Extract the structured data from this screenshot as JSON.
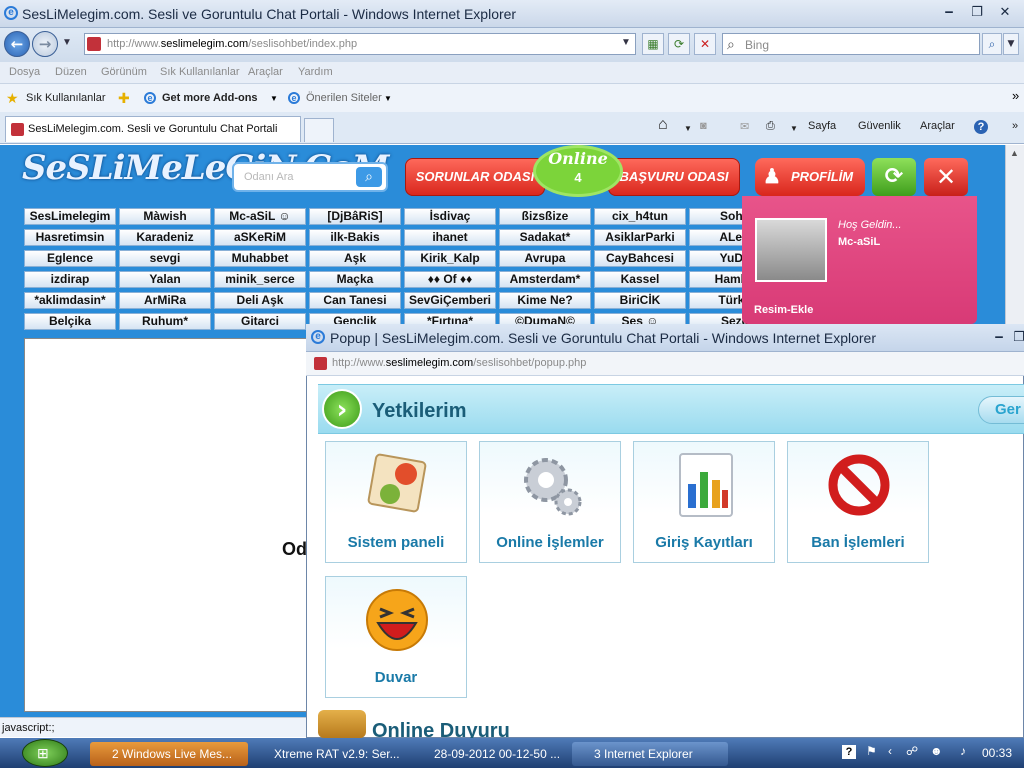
{
  "window": {
    "title": "SesLiMelegim.com. Sesli ve Goruntulu Chat Portali - Windows Internet Explorer"
  },
  "address": {
    "url_prefix": "http://www.",
    "url_domain": "seslimelegim.com",
    "url_path": "/seslisohbet/index.php"
  },
  "search": {
    "placeholder": "Bing"
  },
  "menu": [
    "Dosya",
    "Düzen",
    "Görünüm",
    "Sık Kullanılanlar",
    "Araçlar",
    "Yardım"
  ],
  "favorites": {
    "fav_label": "Sık Kullanılanlar",
    "addons_label": "Get more Add-ons",
    "suggested_label": "Önerilen Siteler"
  },
  "tab": {
    "title": "SesLiMelegim.com. Sesli ve Goruntulu Chat Portali"
  },
  "commandbar": {
    "page": "Sayfa",
    "security": "Güvenlik",
    "tools": "Araçlar"
  },
  "site": {
    "logo": "SeSLiMeLeGiN.CoM",
    "room_search_placeholder": "Odanı Ara",
    "problems_button": "SORUNLAR ODASI",
    "online_label": "Online",
    "online_count": "4",
    "apply_button": "BAŞVURU ODASI",
    "profile_button": "PROFİLİM",
    "welcome": "Hoş Geldin...",
    "username": "Mc-aSiL",
    "add_photo": "Resim-Ekle",
    "chat_overlay_text": "Od"
  },
  "rooms": [
    [
      "SesLimelegim",
      "Màwish",
      "Mc-aSiL ☺",
      "[DjBâRiS]",
      "İsdivaç",
      "ßizsßize",
      "cix_h4tun",
      "Sohb"
    ],
    [
      "Hasretimsin",
      "Karadeniz",
      "aSKeRiM",
      "ilk-Bakis",
      "ihanet",
      "Sadakat*",
      "AsiklarParki",
      "ALeD"
    ],
    [
      "Eglence",
      "sevgi",
      "Muhabbet",
      "Aşk",
      "Kirik_Kalp",
      "Avrupa",
      "CayBahcesi",
      "YuDu"
    ],
    [
      "izdirap",
      "Yalan",
      "minik_serce",
      "Maçka",
      "♦♦ Of ♦♦",
      "Amsterdam*",
      "Kassel",
      "Hambu"
    ],
    [
      "*aklimdasin*",
      "ArMiRa",
      "Deli Aşk",
      "Can Tanesi",
      "SevGiÇemberi",
      "Kime Ne?",
      "BiriCİK",
      "Türkü"
    ],
    [
      "Belçika",
      "Ruhum*",
      "Gitarci",
      "Gençlik",
      "*Fırtına*",
      "©DumaN©",
      "Ses ☺",
      "Sezg"
    ]
  ],
  "status": {
    "text": "javascript:;"
  },
  "popup": {
    "title": "Popup | SesLiMelegim.com. Sesli ve Goruntulu Chat Portali - Windows Internet Explorer",
    "url_prefix": "http://www.",
    "url_domain": "seslimelegim.com",
    "url_path": "/seslisohbet/popup.php",
    "section_title": "Yetkilerim",
    "back_button": "Ger",
    "tiles": [
      "Sistem paneli",
      "Online İşlemler",
      "Giriş Kayıtları",
      "Ban İşlemleri",
      "Duvar"
    ],
    "announcement_title": "Online Duyuru"
  },
  "taskbar": {
    "tasks": [
      "2 Windows Live Mes...",
      "Xtreme RAT v2.9: Ser...",
      "28-09-2012 00-12-50 ...",
      "3 Internet Explorer"
    ],
    "clock": "00:33"
  }
}
